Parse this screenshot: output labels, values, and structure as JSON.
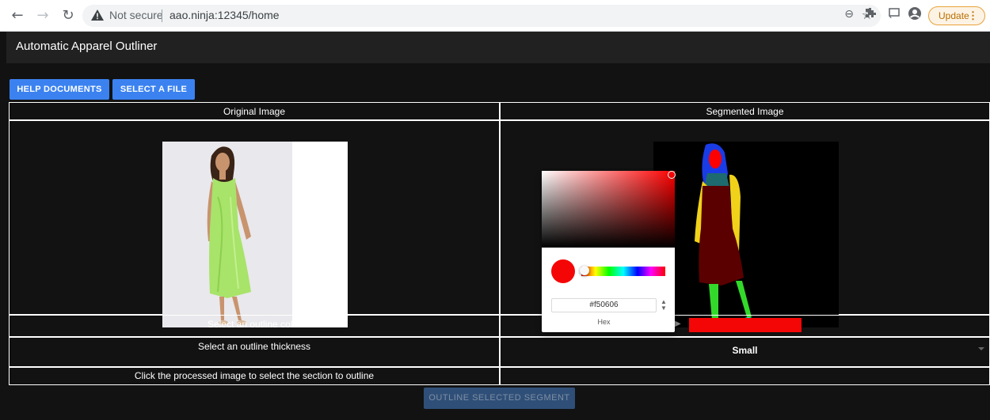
{
  "browser": {
    "back_icon": "arrow-left-icon",
    "forward_icon": "arrow-right-icon",
    "reload_icon": "reload-icon",
    "security_label": "Not secure",
    "url": "aao.ninja:12345/home",
    "update_label": "Update"
  },
  "app": {
    "title": "Automatic Apparel Outliner"
  },
  "toolbar": {
    "help_label": "HELP DOCUMENTS",
    "file_label": "SELECT A FILE"
  },
  "table": {
    "original_header": "Original Image",
    "segmented_header": "Segmented Image",
    "color_label": "Select an outline color",
    "color_value": "#f50606",
    "thickness_label": "Select an outline thickness",
    "thickness_value": "Small",
    "click_instruction": "Click the processed image to select the section to outline"
  },
  "outline_button_label": "OUTLINE SELECTED SEGMENT",
  "color_picker": {
    "hex_value": "#f50606",
    "mode_label": "Hex"
  },
  "colors": {
    "accent": "#3b82f0",
    "selected_color": "#f50606",
    "background": "#121212",
    "header": "#212121"
  }
}
